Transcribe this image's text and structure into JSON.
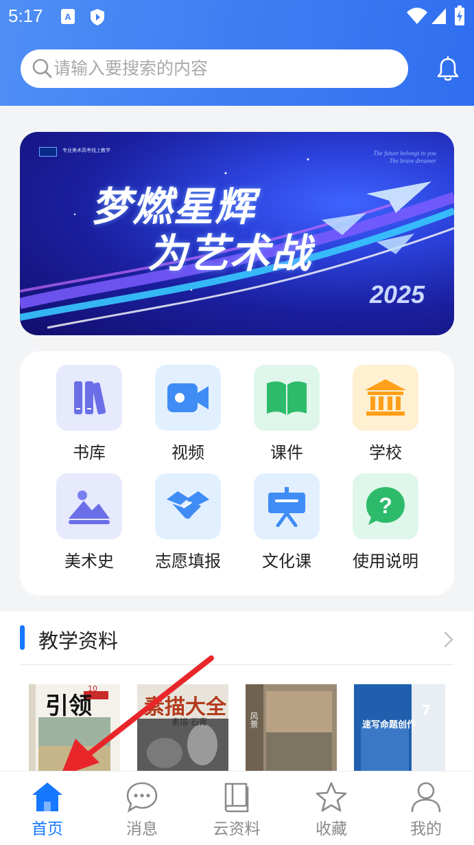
{
  "status_bar": {
    "time": "5:17"
  },
  "search": {
    "placeholder": "请输入要搜索的内容"
  },
  "banner": {
    "small_text": "专业美术高考线上教学",
    "english_line1": "The future belongs to you",
    "english_line2": "The brave dreamer",
    "title_line1": "梦燃星辉",
    "title_line2": "为艺术战",
    "year": "2025"
  },
  "grid": {
    "items": [
      {
        "label": "书库",
        "icon": "bookshelf-icon"
      },
      {
        "label": "视频",
        "icon": "video-camera-icon"
      },
      {
        "label": "课件",
        "icon": "open-book-icon"
      },
      {
        "label": "学校",
        "icon": "school-building-icon"
      },
      {
        "label": "美术史",
        "icon": "landscape-picture-icon"
      },
      {
        "label": "志愿填报",
        "icon": "handshake-icon"
      },
      {
        "label": "文化课",
        "icon": "blackboard-icon"
      },
      {
        "label": "使用说明",
        "icon": "help-question-icon"
      }
    ]
  },
  "section": {
    "title": "教学资料",
    "books": [
      {
        "cover_text": "引领",
        "sub": "10"
      },
      {
        "cover_text": "素描大全",
        "sub": "素描·石膏"
      },
      {
        "cover_text": "风景",
        "sub": ""
      },
      {
        "cover_text": "速写命题创作",
        "sub": "7"
      }
    ]
  },
  "tabbar": {
    "tabs": [
      {
        "label": "首页",
        "active": true
      },
      {
        "label": "消息",
        "active": false
      },
      {
        "label": "云资料",
        "active": false
      },
      {
        "label": "收藏",
        "active": false
      },
      {
        "label": "我的",
        "active": false
      }
    ]
  },
  "colors": {
    "accent": "#1677ff",
    "header": "#3f7ff3",
    "annotation_arrow": "#e8262a"
  }
}
